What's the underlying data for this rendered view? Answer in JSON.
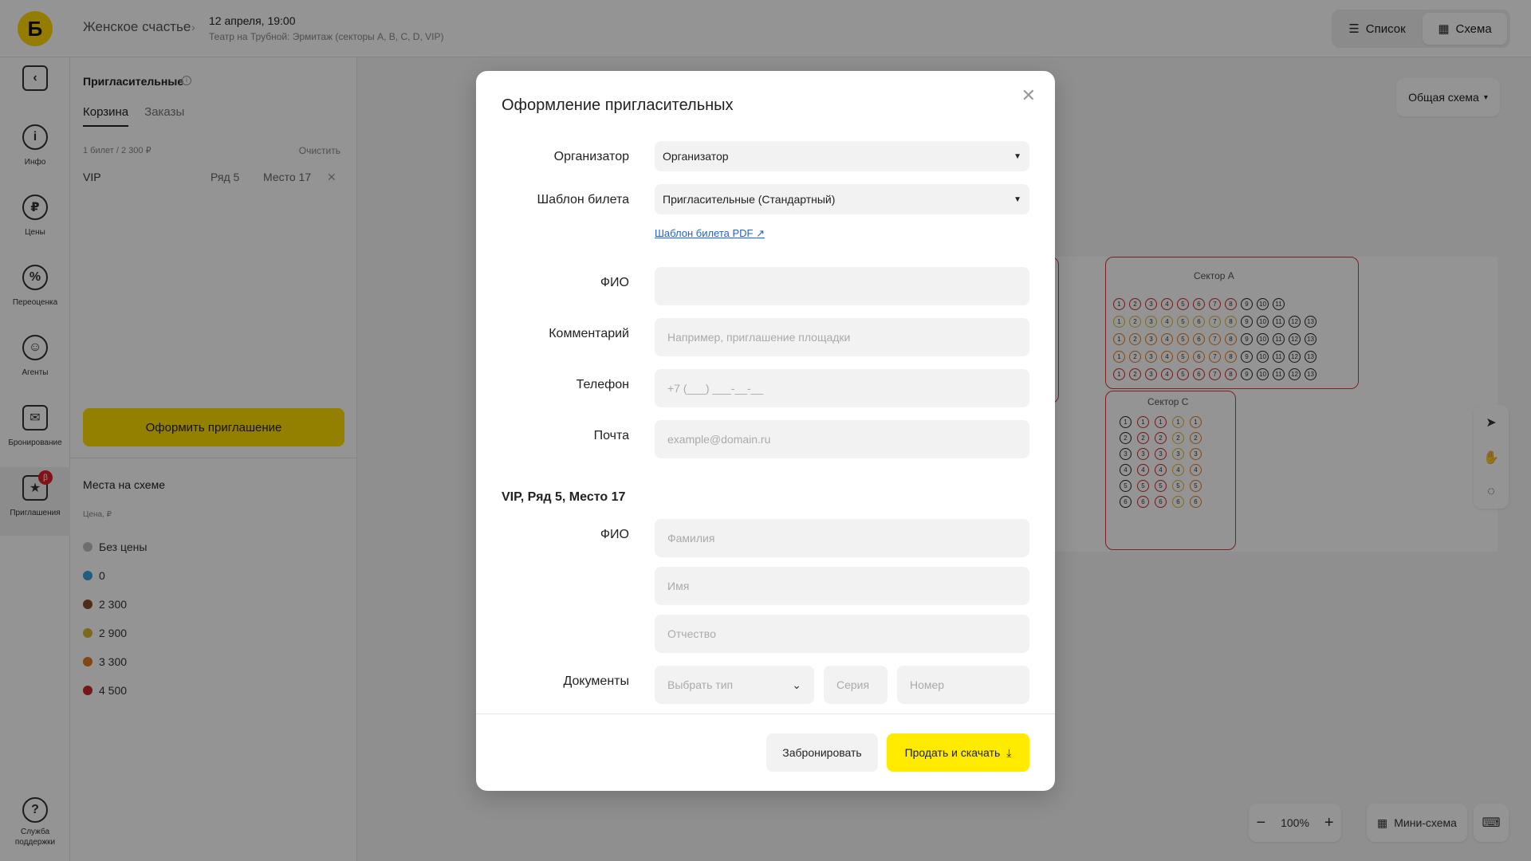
{
  "header": {
    "logo": "Б",
    "event_title": "Женское счастье",
    "event_date": "12 апреля, 19:00",
    "venue": "Театр на Трубной: Эрмитаж (секторы A, B, C, D, VIP)",
    "view_list": "Список",
    "view_scheme": "Схема"
  },
  "rail": {
    "items": [
      {
        "label": "Инфо",
        "glyph": "i"
      },
      {
        "label": "Цены",
        "glyph": "₽"
      },
      {
        "label": "Переоценка",
        "glyph": "%"
      },
      {
        "label": "Агенты",
        "glyph": "☺"
      },
      {
        "label": "Бронирование",
        "glyph": "✉"
      },
      {
        "label": "Приглашения",
        "glyph": "★"
      }
    ],
    "badge": "β",
    "support_label_1": "Служба",
    "support_label_2": "поддержки",
    "support_glyph": "?"
  },
  "panel": {
    "title": "Пригласительные",
    "tabs": [
      "Корзина",
      "Заказы"
    ],
    "summary": "1 билет / 2 300 ₽",
    "clear": "Очистить",
    "cart_item": {
      "sector": "VIP",
      "row": "Ряд 5",
      "seat": "Место 17"
    },
    "invite_button": "Оформить приглашение",
    "legend_title": "Места на схеме",
    "legend_sub": "Цена, ₽",
    "legend": [
      {
        "label": "Без цены",
        "color": "#bdbdbd"
      },
      {
        "label": "0",
        "color": "#3aa0d8"
      },
      {
        "label": "2 300",
        "color": "#8b4a2c"
      },
      {
        "label": "2 900",
        "color": "#d8b634"
      },
      {
        "label": "3 300",
        "color": "#e07a1f"
      },
      {
        "label": "4 500",
        "color": "#c62828"
      }
    ]
  },
  "main": {
    "scheme_select": "Общая схема",
    "sector_a": "Сектор A",
    "sector_c": "Сектор C",
    "zoom": "100%",
    "mini_scheme": "Мини-схема"
  },
  "modal": {
    "title": "Оформление пригласительных",
    "organizer_label": "Организатор",
    "organizer_value": "Организатор",
    "template_label": "Шаблон билета",
    "template_value": "Пригласительные (Стандартный)",
    "pdf_link": "Шаблон билета PDF",
    "fio_label": "ФИО",
    "comment_label": "Комментарий",
    "comment_placeholder": "Например, приглашение площадки",
    "phone_label": "Телефон",
    "phone_placeholder": "+7 (___) ___-__-__",
    "email_label": "Почта",
    "email_placeholder": "example@domain.ru",
    "seat_section": "VIP, Ряд 5, Место 17",
    "seat_fio_label": "ФИО",
    "surname_placeholder": "Фамилия",
    "name_placeholder": "Имя",
    "patronymic_placeholder": "Отчество",
    "documents_label": "Документы",
    "doc_type_placeholder": "Выбрать тип",
    "series_placeholder": "Серия",
    "number_placeholder": "Номер",
    "reserve_button": "Забронировать",
    "sell_button": "Продать и скачать"
  }
}
